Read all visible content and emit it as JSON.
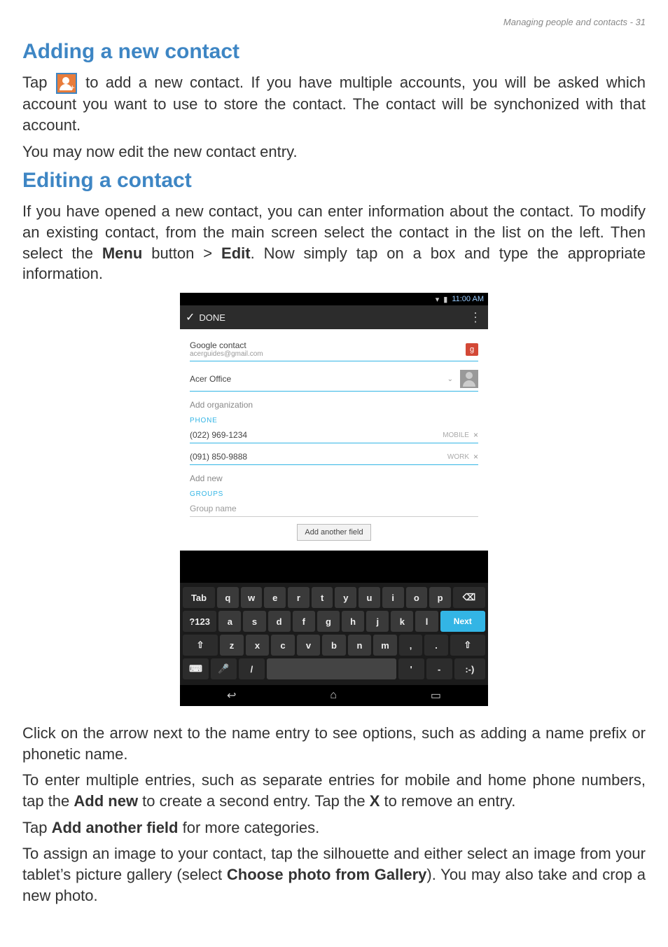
{
  "page_header": "Managing people and contacts - 31",
  "section1": {
    "title": "Adding a new contact"
  },
  "p1a": "Tap ",
  "p1b": " to add a new contact. If you have multiple accounts, you will be asked which account you want to use to store the contact. The contact will be synchonized with that account.",
  "p2": "You may now edit the new contact entry.",
  "section2": {
    "title": "Editing a contact"
  },
  "p3a": "If you have opened a new contact, you can enter information about the contact. To modify an existing contact, from the main screen select the contact in the  list on the left. Then select the ",
  "p3b": "Menu",
  "p3c": " button > ",
  "p3d": "Edit",
  "p3e": ". Now simply tap on a box and type the appropriate information.",
  "shot": {
    "status_time": "11:00 AM",
    "done_label": "DONE",
    "google_contact": "Google contact",
    "google_email": "acerguides@gmail.com",
    "g_badge": "g",
    "name_value": "Acer Office",
    "add_org": "Add organization",
    "phone_label": "PHONE",
    "phone1": "(022) 969-1234",
    "phone1_type": "MOBILE",
    "phone2": "(091) 850-9888",
    "phone2_type": "WORK",
    "add_new": "Add new",
    "groups_label": "GROUPS",
    "group_name": "Group name",
    "add_another_field": "Add another field",
    "keys_row1_left": "Tab",
    "keys_row1": [
      "q",
      "w",
      "e",
      "r",
      "t",
      "y",
      "u",
      "i",
      "o",
      "p"
    ],
    "keys_row1_right": "⌫",
    "keys_row2_left": "?123",
    "keys_row2": [
      "a",
      "s",
      "d",
      "f",
      "g",
      "h",
      "j",
      "k",
      "l"
    ],
    "keys_row2_right": "Next",
    "keys_row3_left": "⇧",
    "keys_row3": [
      "z",
      "x",
      "c",
      "v",
      "b",
      "n",
      "m",
      ",",
      "."
    ],
    "keys_row3_right": "⇧",
    "keys_row4": {
      "globe": "⌨",
      "mic": "🎤",
      "slash": "/",
      "comma": "'",
      "dash": "-",
      "smile": ":-)"
    }
  },
  "p4": "Click on the arrow next to the name entry to see options, such as adding a name prefix or phonetic name.",
  "p5a": "To enter multiple entries, such as separate entries for mobile and home phone numbers, tap the ",
  "p5b": "Add new",
  "p5c": " to create a second entry. Tap the ",
  "p5d": "X",
  "p5e": " to remove an entry.",
  "p6a": "Tap ",
  "p6b": "Add another field",
  "p6c": " for more categories.",
  "p7a": "To assign an image to your contact, tap the silhouette and either select an image from your tablet’s picture gallery (select ",
  "p7b": "Choose photo from Gallery",
  "p7c": "). You may also take and crop a new photo."
}
